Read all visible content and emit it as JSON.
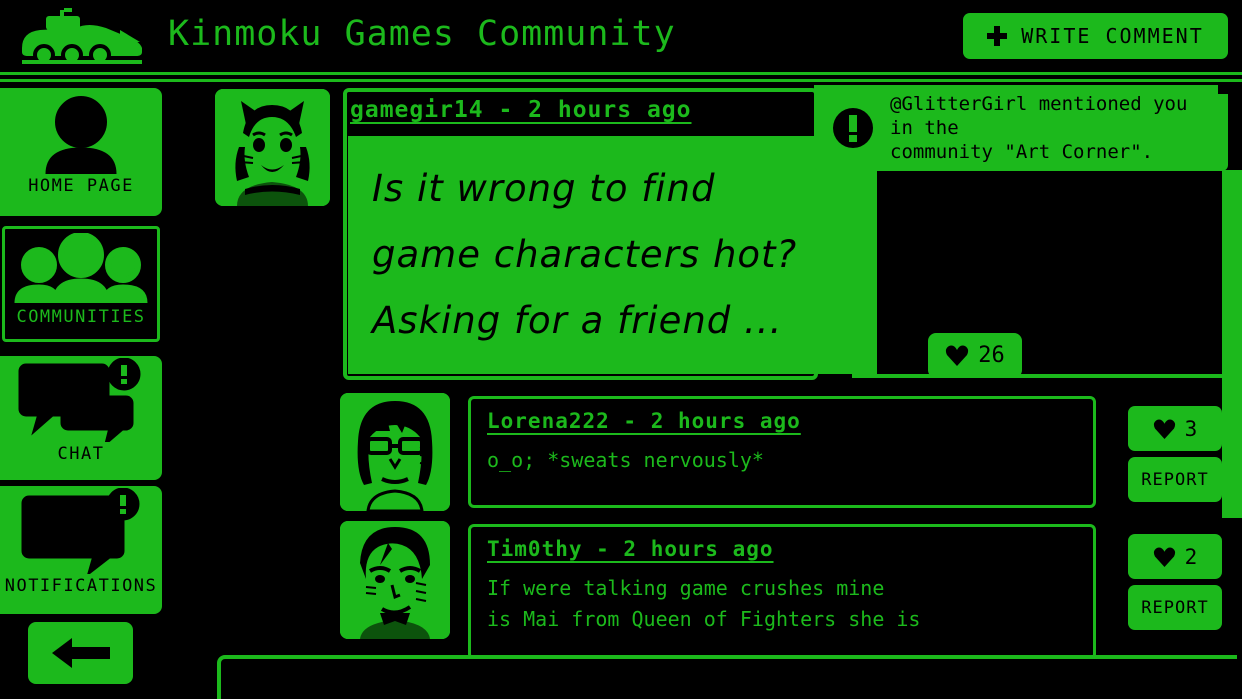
{
  "theme": {
    "green": "#1cb91c",
    "black": "#000000"
  },
  "header": {
    "title": "Kinmoku Games Community",
    "write_comment_label": "WRITE COMMENT",
    "plus_icon": "plus-icon",
    "logo_icon": "car-logo-icon"
  },
  "sidebar": {
    "items": [
      {
        "label": "HOME PAGE",
        "icon": "user-avatar-icon",
        "selected": false,
        "badge": false
      },
      {
        "label": "COMMUNITIES",
        "icon": "group-people-icon",
        "selected": true,
        "badge": false
      },
      {
        "label": "CHAT",
        "icon": "chat-bubbles-icon",
        "selected": false,
        "badge": true
      },
      {
        "label": "NOTIFICATIONS",
        "icon": "message-lines-icon",
        "selected": false,
        "badge": true
      }
    ],
    "back_button": {
      "icon": "arrow-left-icon",
      "label": ""
    }
  },
  "post": {
    "author_line": "gamegir14 - 2 hours ago",
    "avatar": "cat-girl-avatar",
    "body_lines": [
      "Is it wrong to find",
      "game characters hot?",
      "Asking for a friend ..."
    ],
    "like_count": "26",
    "heart_icon": "heart-icon"
  },
  "comments": [
    {
      "author_line": "Lorena222 - 2 hours ago",
      "avatar": "bob-haircut-glasses-avatar",
      "text_lines": [
        "o_o; *sweats nervously*"
      ],
      "like_count": "3",
      "report_label": "REPORT",
      "heart_icon": "heart-icon"
    },
    {
      "author_line": "Tim0thy - 2 hours ago",
      "avatar": "short-hair-boy-avatar",
      "text_lines": [
        "If were talking game crushes mine",
        "is Mai from Queen of Fighters she is"
      ],
      "like_count": "2",
      "report_label": "REPORT",
      "heart_icon": "heart-icon"
    }
  ],
  "notification": {
    "icon": "exclamation-circle-icon",
    "line1": "@GlitterGirl mentioned you in the",
    "line2": "community \"Art Corner\"."
  },
  "scrollbar": {
    "name": "vertical-scrollbar"
  }
}
